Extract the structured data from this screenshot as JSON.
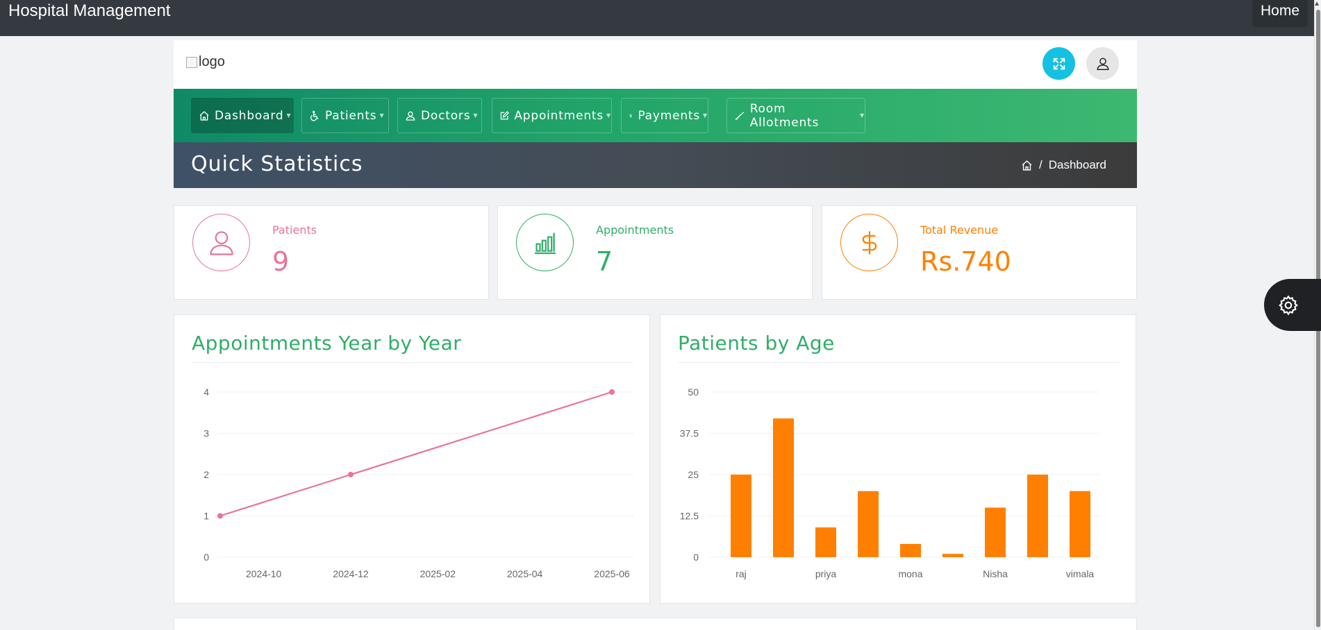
{
  "app": {
    "title": "Hospital Management",
    "home_label": "Home"
  },
  "header": {
    "logo_alt": "logo"
  },
  "nav": {
    "items": [
      {
        "label": "Dashboard",
        "icon": "home-icon"
      },
      {
        "label": "Patients",
        "icon": "wheelchair-icon"
      },
      {
        "label": "Doctors",
        "icon": "user-icon"
      },
      {
        "label": "Appointments",
        "icon": "edit-icon"
      },
      {
        "label": "Payments",
        "icon": "dollar-icon"
      },
      {
        "label": "Room Allotments",
        "icon": "bed-icon"
      }
    ]
  },
  "page": {
    "title": "Quick Statistics",
    "breadcrumb": "Dashboard",
    "breadcrumb_sep": "/"
  },
  "stats": [
    {
      "label": "Patients",
      "value": "9",
      "color": "#e8739b",
      "icon": "user-icon"
    },
    {
      "label": "Appointments",
      "value": "7",
      "color": "#2fae67",
      "icon": "bar-chart-icon"
    },
    {
      "label": "Total Revenue",
      "value": "Rs.740",
      "color": "#ff8000",
      "icon": "dollar-icon"
    }
  ],
  "chart_data": [
    {
      "type": "line",
      "title": "Appointments Year by Year",
      "x": [
        "2024-09",
        "2024-12",
        "2025-06"
      ],
      "xticks": [
        "2024-10",
        "2024-12",
        "2025-02",
        "2025-04",
        "2025-06"
      ],
      "series": [
        {
          "values": [
            1,
            2,
            4
          ],
          "color": "#e8739b"
        }
      ],
      "yticks": [
        "0",
        "1",
        "2",
        "3",
        "4"
      ],
      "ylim": [
        0,
        4
      ],
      "grid": true
    },
    {
      "type": "bar",
      "title": "Patients by Age",
      "categories": [
        "raj",
        "",
        "priya",
        "",
        "mona",
        "",
        "Nisha",
        "",
        "vimala"
      ],
      "values": [
        25,
        42,
        9,
        20,
        4,
        1,
        15,
        25,
        20
      ],
      "color": "#ff8000",
      "yticks": [
        "0",
        "12.5",
        "25",
        "37.5",
        "50"
      ],
      "ylim": [
        0,
        50
      ],
      "grid": true
    }
  ]
}
